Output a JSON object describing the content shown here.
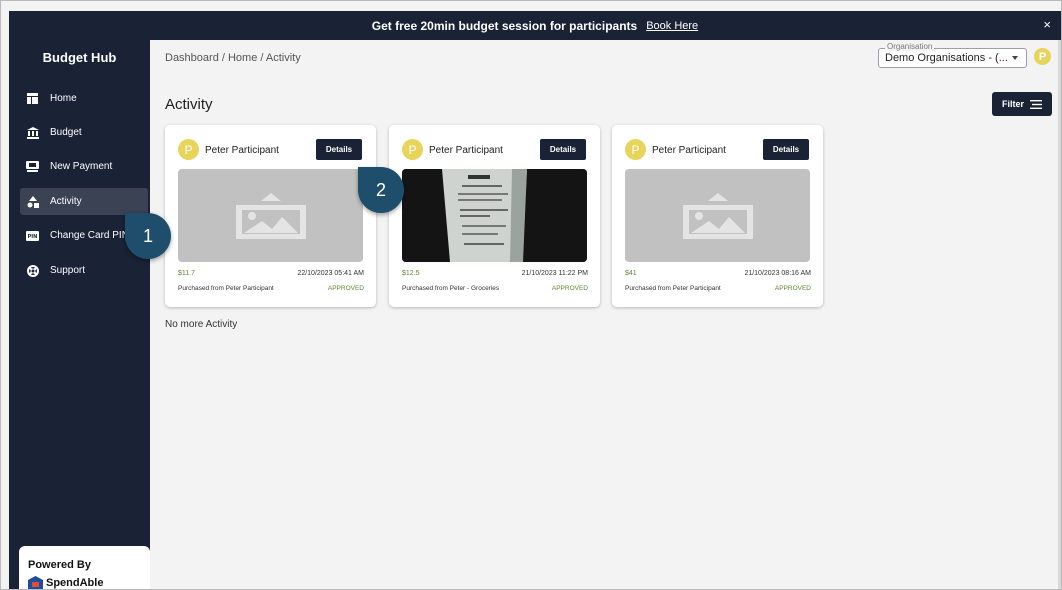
{
  "banner": {
    "message": "Get free 20min budget session for participants",
    "link": "Book Here",
    "close": "×"
  },
  "sidebar": {
    "brand": "Budget Hub",
    "items": [
      {
        "label": "Home",
        "icon": "home-icon"
      },
      {
        "label": "Budget",
        "icon": "bank-icon"
      },
      {
        "label": "New Payment",
        "icon": "payment-icon"
      },
      {
        "label": "Activity",
        "icon": "shapes-icon",
        "active": true
      },
      {
        "label": "Change Card PIN",
        "icon": "pin-icon"
      },
      {
        "label": "Support",
        "icon": "lifebuoy-icon"
      }
    ],
    "powered_by": "Powered By",
    "powered_brand": "SpendAble"
  },
  "header": {
    "breadcrumb": "Dashboard / Home / Activity",
    "org_legend": "Organisation",
    "org_value": "Demo Organisations - (...",
    "avatar_initial": "P"
  },
  "page": {
    "title": "Activity",
    "filter_label": "Filter",
    "no_more": "No more Activity"
  },
  "cards": [
    {
      "initial": "P",
      "name": "Peter Participant",
      "details": "Details",
      "amount": "$11.7",
      "date": "22/10/2023 05:41 AM",
      "desc": "Purchased from Peter Participant",
      "status": "APPROVED",
      "image": "placeholder"
    },
    {
      "initial": "P",
      "name": "Peter Participant",
      "details": "Details",
      "amount": "$12.5",
      "date": "21/10/2023 11:22 PM",
      "desc": "Purchased from Peter - Groceries",
      "status": "APPROVED",
      "image": "receipt-photo"
    },
    {
      "initial": "P",
      "name": "Peter Participant",
      "details": "Details",
      "amount": "$41",
      "date": "21/10/2023 08:16 AM",
      "desc": "Purchased from Peter Participant",
      "status": "APPROVED",
      "image": "placeholder"
    }
  ],
  "callouts": [
    "1",
    "2"
  ],
  "colors": {
    "navy": "#1a2236",
    "approved": "#5a8a2e",
    "avatar": "#e6d45b",
    "callout": "#1f4e6d"
  }
}
